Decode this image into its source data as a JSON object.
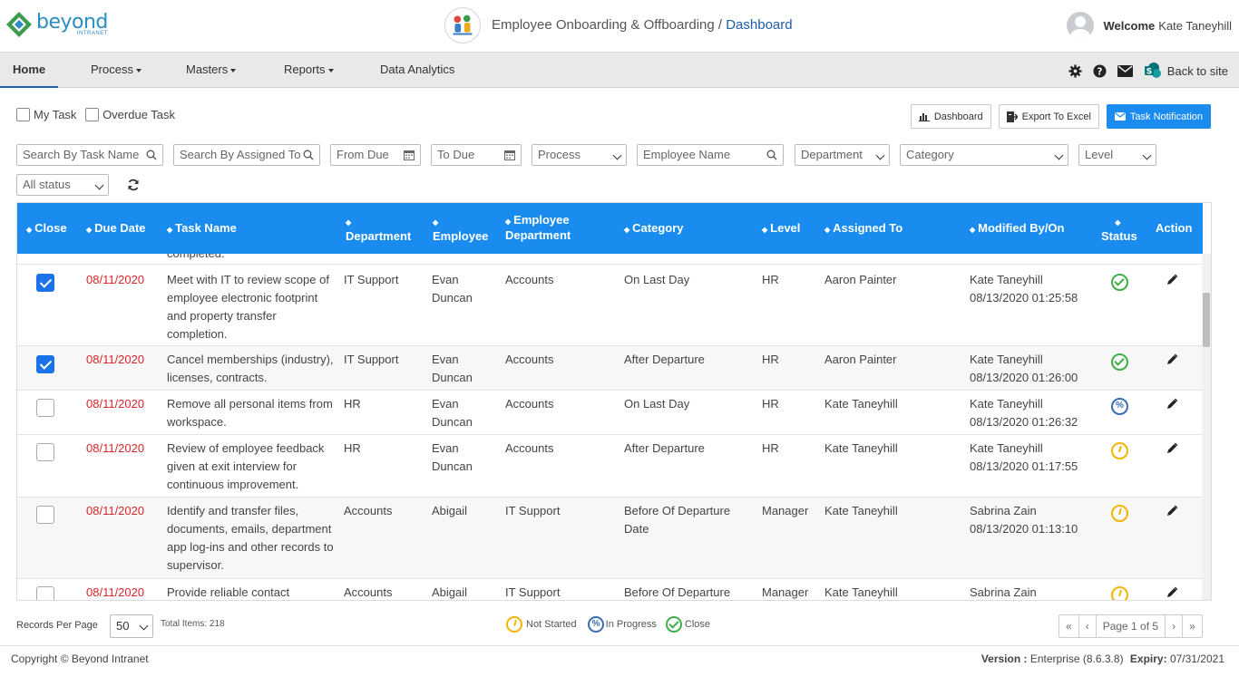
{
  "brand": {
    "name": "beyond",
    "sub": "INTRANET"
  },
  "header": {
    "app_name": "Employee Onboarding & Offboarding / ",
    "crumb": "Dashboard",
    "welcome": "Welcome",
    "user_name": "Kate Taneyhill"
  },
  "nav": {
    "home": "Home",
    "process": "Process",
    "masters": "Masters",
    "reports": "Reports",
    "analytics": "Data Analytics",
    "back": "Back to site"
  },
  "toolbar": {
    "my_task": "My Task",
    "overdue_task": "Overdue Task",
    "dashboard_btn": "Dashboard",
    "export_btn": "Export To Excel",
    "notify_btn": "Task Notification"
  },
  "filters": {
    "task_name": "Search By Task Name",
    "assigned_to": "Search By Assigned To",
    "from_due": "From Due",
    "to_due": "To Due",
    "process": "Process",
    "employee_name": "Employee Name",
    "department": "Department",
    "category": "Category",
    "level": "Level",
    "status": "All status"
  },
  "table": {
    "headers": {
      "close": "Close",
      "due": "Due Date",
      "task": "Task Name",
      "dept": "Department",
      "emp": "Employee",
      "empdept": "Employee Department",
      "cat": "Category",
      "level": "Level",
      "assigned": "Assigned To",
      "modified": "Modified By/On",
      "status": "Status",
      "action": "Action"
    },
    "partial_text": "completed.",
    "rows": [
      {
        "checked": true,
        "due": "08/11/2020",
        "task": "Meet with IT to review scope of employee electronic footprint and property transfer completion.",
        "dept": "IT Support",
        "emp": "Evan Duncan",
        "empdept": "Accounts",
        "cat": "On Last Day",
        "level": "HR",
        "assigned": "Aaron Painter",
        "mod_by": "Kate Taneyhill",
        "mod_on": "08/13/2020 01:25:58",
        "status": "close"
      },
      {
        "checked": true,
        "due": "08/11/2020",
        "task": "Cancel memberships (industry), licenses, contracts.",
        "dept": "IT Support",
        "emp": "Evan Duncan",
        "empdept": "Accounts",
        "cat": "After Departure",
        "level": "HR",
        "assigned": "Aaron Painter",
        "mod_by": "Kate Taneyhill",
        "mod_on": "08/13/2020 01:26:00",
        "status": "close"
      },
      {
        "checked": false,
        "due": "08/11/2020",
        "task": "Remove all personal items from workspace.",
        "dept": "HR",
        "emp": "Evan Duncan",
        "empdept": "Accounts",
        "cat": "On Last Day",
        "level": "HR",
        "assigned": "Kate Taneyhill",
        "mod_by": "Kate Taneyhill",
        "mod_on": "08/13/2020 01:26:32",
        "status": "progress"
      },
      {
        "checked": false,
        "due": "08/11/2020",
        "task": "Review of employee feedback given at exit interview for continuous improvement.",
        "dept": "HR",
        "emp": "Evan Duncan",
        "empdept": "Accounts",
        "cat": "After Departure",
        "level": "HR",
        "assigned": "Kate Taneyhill",
        "mod_by": "Kate Taneyhill",
        "mod_on": "08/13/2020 01:17:55",
        "status": "notstarted"
      },
      {
        "checked": false,
        "due": "08/11/2020",
        "task": "Identify and transfer files, documents, emails, department app log-ins and other records to supervisor.",
        "dept": "Accounts",
        "emp": "Abigail",
        "empdept": "IT Support",
        "cat": "Before Of Departure Date",
        "level": "Manager",
        "assigned": "Kate Taneyhill",
        "mod_by": "Sabrina Zain",
        "mod_on": "08/13/2020 01:13:10",
        "status": "notstarted"
      },
      {
        "checked": false,
        "due": "08/11/2020",
        "task": "Provide reliable contact",
        "dept": "Accounts",
        "emp": "Abigail",
        "empdept": "IT Support",
        "cat": "Before Of Departure",
        "level": "Manager",
        "assigned": "Kate Taneyhill",
        "mod_by": "Sabrina Zain",
        "mod_on": "",
        "status": "notstarted"
      }
    ]
  },
  "footer": {
    "records_per_page": "Records Per Page",
    "per_page_value": "50",
    "total_items": "Total Items: 218",
    "legend_not_started": "Not Started",
    "legend_in_progress": "In Progress",
    "legend_close": "Close",
    "page_info": "Page 1 of 5",
    "first": "«",
    "prev": "‹",
    "next": "›",
    "last": "»"
  },
  "copyright": {
    "text": "Copyright © Beyond Intranet",
    "version_label": "Version :",
    "version_value": "Enterprise (8.6.3.8)",
    "expiry_label": "Expiry:",
    "expiry_value": "07/31/2021"
  },
  "colors": {
    "accent": "#1a8cf0",
    "header_blue": "#1d5ea8",
    "due_red": "#d9262b",
    "close_green": "#3fae49",
    "not_started_yellow": "#f2b600",
    "in_progress_blue": "#3a6db4"
  }
}
